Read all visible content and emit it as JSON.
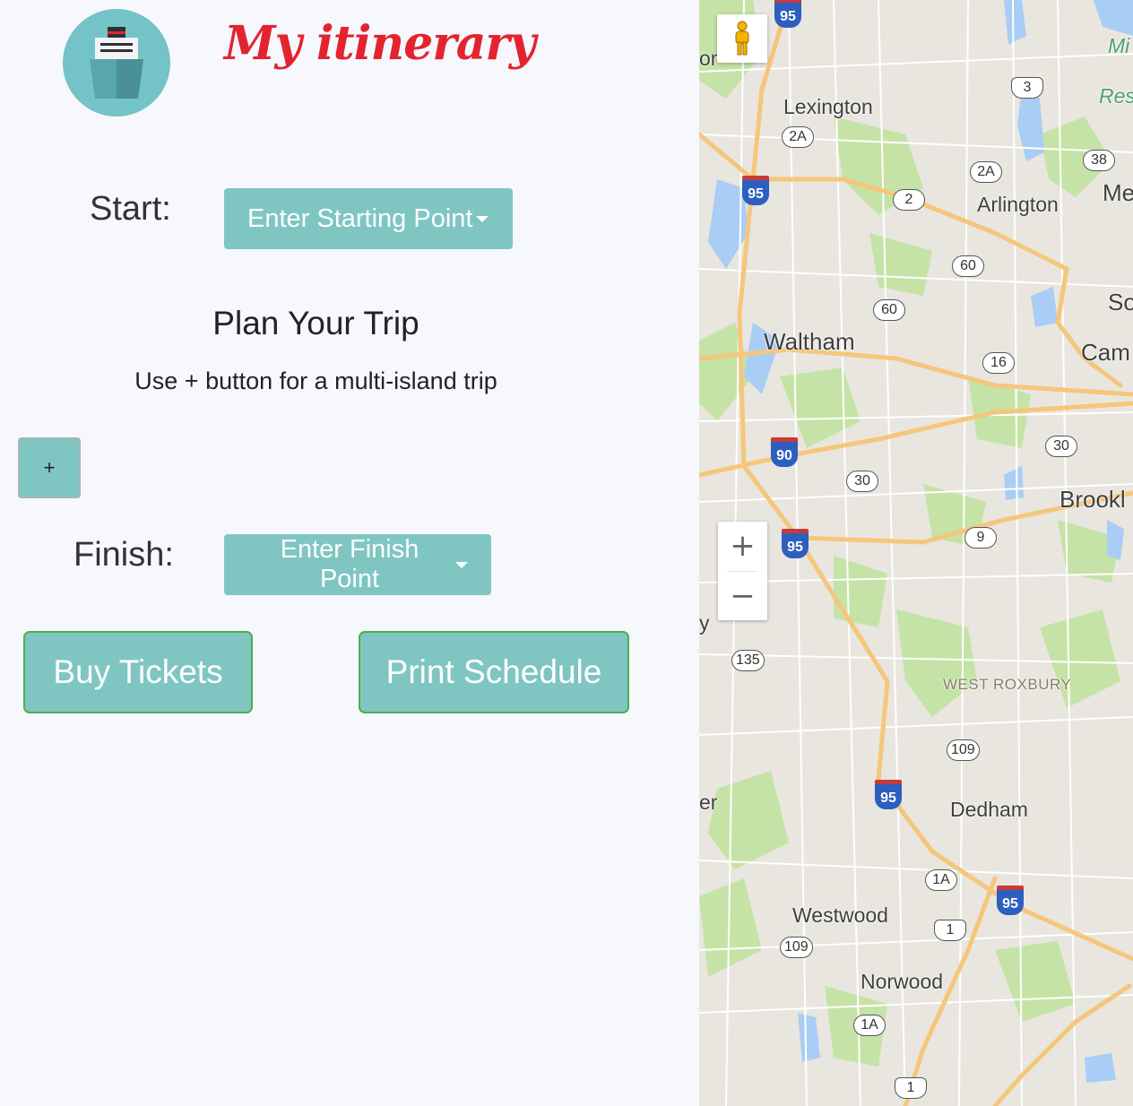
{
  "app": {
    "title": "My itinerary",
    "logo_icon": "cruise-ship-icon"
  },
  "start": {
    "label": "Start:",
    "dropdown_label": "Enter Starting Point"
  },
  "plan": {
    "heading": "Plan Your Trip",
    "subtitle": "Use + button for a multi-island trip",
    "add_button": "+"
  },
  "finish": {
    "label": "Finish:",
    "dropdown_label": "Enter Finish Point"
  },
  "actions": {
    "buy": "Buy Tickets",
    "print": "Print Schedule"
  },
  "map": {
    "zoom_in": "+",
    "zoom_out": "−",
    "places": {
      "lexington": "Lexington",
      "arlington": "Arlington",
      "waltham": "Waltham",
      "west_roxbury": "WEST ROXBURY",
      "dedham": "Dedham",
      "westwood": "Westwood",
      "norwood": "Norwood",
      "brookline": "Brookl",
      "cambridge": "Cam",
      "somerville": "So",
      "medford": "Me",
      "mi": "Mi",
      "res": "Res",
      "edge_or": "or",
      "edge_y": "y",
      "edge_er": "er"
    },
    "routes": {
      "r2a_a": "2A",
      "r2a_b": "2A",
      "r2": "2",
      "r3": "3",
      "r38": "38",
      "r60_a": "60",
      "r60_b": "60",
      "r16": "16",
      "r30_a": "30",
      "r30_b": "30",
      "r9": "9",
      "r135": "135",
      "r109_a": "109",
      "r109_b": "109",
      "r1a_a": "1A",
      "r1a_b": "1A",
      "r1_a": "1",
      "r1_b": "1",
      "i95_a": "95",
      "i95_b": "95",
      "i95_c": "95",
      "i95_d": "95",
      "i95_e": "95",
      "i90": "90"
    },
    "colors": {
      "land": "#e8e6df",
      "park": "#c5e3a6",
      "water": "#a9cdf5",
      "highway": "#f5c67b",
      "road": "#ffffff"
    }
  }
}
